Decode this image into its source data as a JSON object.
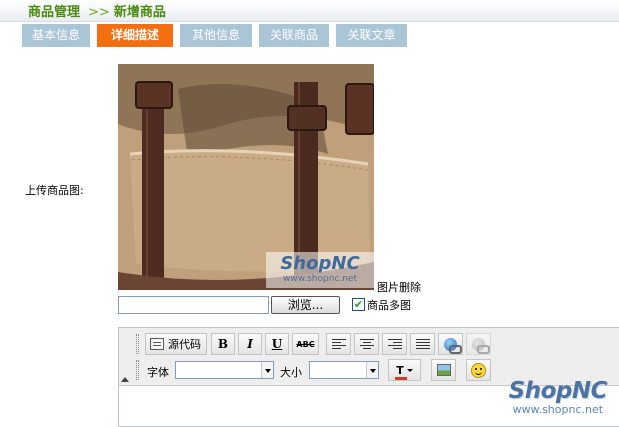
{
  "header": {
    "breadcrumb_root": "商品管理",
    "breadcrumb_sep": ">>",
    "breadcrumb_current": "新增商品"
  },
  "tabs": [
    {
      "label": "基本信息",
      "active": false
    },
    {
      "label": "详细描述",
      "active": true
    },
    {
      "label": "其他信息",
      "active": false
    },
    {
      "label": "关联商品",
      "active": false
    },
    {
      "label": "关联文章",
      "active": false
    }
  ],
  "form": {
    "upload_label": "上传商品图:",
    "image_watermark": {
      "brand": "ShopNC",
      "url": "www.shopnc.net"
    },
    "delete_label": "图片删除",
    "file_value": "",
    "browse_label": "浏览...",
    "multi_image_label": "商品多图",
    "multi_image_checked": true
  },
  "editor": {
    "source_label": "源代码",
    "bold": "B",
    "italic": "I",
    "underline": "U",
    "strike": "ABC",
    "font_label": "字体",
    "size_label": "大小",
    "font_value": "",
    "size_value": "",
    "color_icon": "T",
    "icons": [
      "source-code-icon",
      "align-left-icon",
      "align-center-icon",
      "align-right-icon",
      "align-justify-icon",
      "link-icon",
      "unlink-icon",
      "text-color-icon",
      "insert-image-icon",
      "emoticon-icon"
    ]
  },
  "watermark": {
    "brand": "ShopNC",
    "url": "www.shopnc.net"
  },
  "colors": {
    "accent_green": "#4a8a10",
    "tab_active": "#f46f12",
    "tab_inactive": "#a9c5d6"
  }
}
